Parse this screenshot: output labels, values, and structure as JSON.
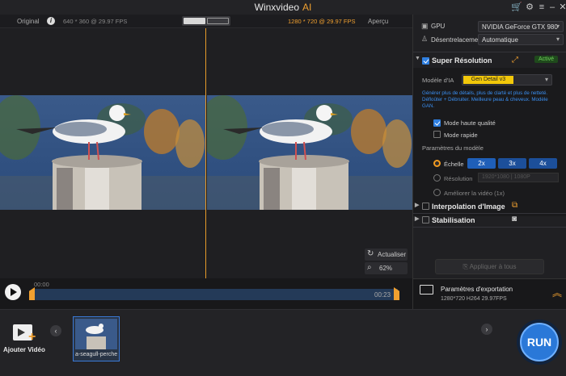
{
  "app": {
    "title": "Winxvideo",
    "title_ai": "AI"
  },
  "icons": {
    "cart": "cart-icon",
    "settings": "gear-icon",
    "menu": "menu-icon",
    "minimize": "minimize-icon",
    "close": "close-icon"
  },
  "preview": {
    "left_label": "Original",
    "left_info": "640 * 360 @ 29.97 FPS",
    "right_info": "1280 * 720 @ 29.97 FPS",
    "right_label": "Aperçu",
    "refresh_label": "Actualiser",
    "zoom_label": "62%"
  },
  "playback": {
    "time_start": "00:00",
    "time_end": "00:23"
  },
  "bottom": {
    "add_video_label": "Ajouter Vidéo",
    "thumbnail_label": "a-seagull-perche",
    "run_label": "RUN"
  },
  "panel": {
    "gpu_label": "GPU",
    "gpu_value": "NVIDIA GeForce GTX 980",
    "deinterlace_label": "Désentrelacement",
    "deinterlace_value": "Automatique",
    "super_res": {
      "title": "Super Résolution",
      "badge": "Activé",
      "checked": true
    },
    "model_label": "Modèle d'IA",
    "model_value": "Gen Detail v3",
    "model_desc": "Générer plus de détails, plus de clarté et plus de netteté. Défloûter + Débruiter. Meilleure peau & cheveux. Modèle GAN.",
    "hq_label": "Mode haute qualité",
    "fast_label": "Mode rapide",
    "params_label": "Paramètres du modèle",
    "scale_label": "Échelle",
    "scales": [
      "2x",
      "3x",
      "4x"
    ],
    "resolution_label": "Résolution",
    "resolution_value": "1920*1080 | 1080P",
    "enhance_label": "Améliorer la vidéo (1x)",
    "interp_label": "Interpolation d'Image",
    "stab_label": "Stabilisation",
    "apply_all_label": "Appliquer à tous",
    "export": {
      "title": "Paramètres d'exportation",
      "details": "1280*720  H264  29.97FPS"
    }
  },
  "colors": {
    "accent": "#f0a030",
    "blue": "#1f5fb8",
    "green": "#3a8a2a"
  }
}
